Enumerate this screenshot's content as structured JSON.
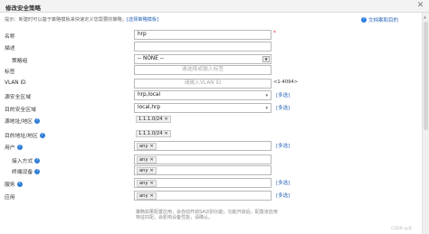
{
  "dialog": {
    "title": "修改安全策略",
    "close_symbol": "✕"
  },
  "hint": {
    "text": "提示：新建时可以基于策略模板来快速定义您需要的策略。",
    "link": "[选择策略模板]"
  },
  "help": {
    "label": "文档案和目的"
  },
  "form": {
    "name": {
      "label": "名称",
      "value": "hrp",
      "required_mark": "*"
    },
    "description": {
      "label": "描述",
      "value": ""
    },
    "policy_group": {
      "label": "策略组",
      "value": "-- NONE --"
    },
    "tags": {
      "label": "标签",
      "placeholder": "请选择或输入标签"
    },
    "vlan_id": {
      "label": "VLAN ID",
      "placeholder": "请输入VLAN ID",
      "range": "<1-4094>"
    },
    "source_zone": {
      "label": "源安全区域",
      "value": "hrp,local",
      "more": "[多选]"
    },
    "dest_zone": {
      "label": "目的安全区域",
      "value": "local,hrp",
      "more": "[多选]"
    },
    "source_address": {
      "label": "源地址/地区",
      "tag": "1.1.1.0/24"
    },
    "dest_address": {
      "label": "目的地址/地区",
      "tag": "1.1.1.0/24"
    },
    "user": {
      "label": "用户",
      "tag": "any",
      "more": "[多选]"
    },
    "access_mode": {
      "label": "接入方式",
      "tag": "any"
    },
    "terminal_device": {
      "label": "终端设备",
      "tag": "any"
    },
    "service": {
      "label": "服务",
      "tag": "any",
      "more": "[多选]"
    },
    "application": {
      "label": "应用",
      "tag": "any",
      "more": "[多选]"
    }
  },
  "app_note": "策略如果配置应用，会自动开启SA识别功能，功能开启后，配置该应用特征匹配，会影响设备性能，请确认。",
  "watermark": "CSDN @龙",
  "colors": {
    "link": "#2a66b8",
    "required": "#dd3333",
    "help_icon": "#2f7fd7"
  }
}
